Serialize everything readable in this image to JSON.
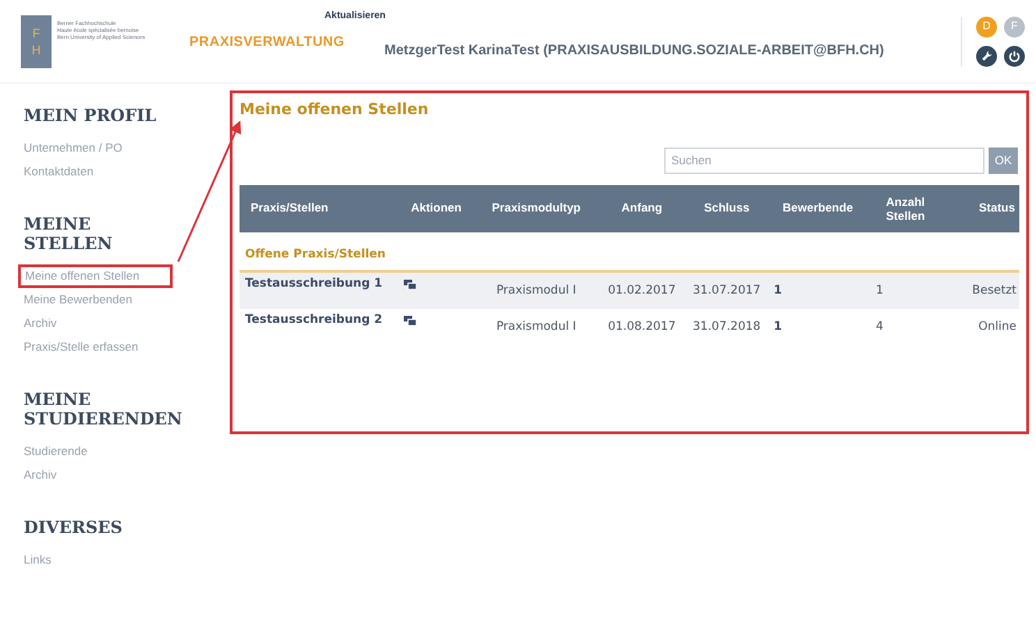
{
  "header": {
    "logo_letters": [
      "F",
      "H"
    ],
    "logo_lines": [
      "Berner Fachhochschule",
      "Haute école spécialisée bernoise",
      "Bern University of Applied Sciences"
    ],
    "refresh_link": "Aktualisieren",
    "app_title": "PRAXISVERWALTUNG",
    "user": "MetzgerTest KarinaTest (PRAXISAUSBILDUNG.SOZIALE-ARBEIT@BFH.CH)",
    "languages": [
      {
        "label": "D",
        "selected": true
      },
      {
        "label": "F",
        "selected": false
      }
    ]
  },
  "sidebar": [
    {
      "title": "MEIN PROFIL",
      "items": [
        {
          "label": "Unternehmen / PO",
          "selected": false
        },
        {
          "label": "Kontaktdaten",
          "selected": false
        }
      ]
    },
    {
      "title": "MEINE STELLEN",
      "items": [
        {
          "label": "Meine offenen Stellen",
          "selected": true
        },
        {
          "label": "Meine Bewerbenden",
          "selected": false
        },
        {
          "label": "Archiv",
          "selected": false
        },
        {
          "label": "Praxis/Stelle erfassen",
          "selected": false
        }
      ]
    },
    {
      "title": "MEINE STUDIERENDEN",
      "items": [
        {
          "label": "Studierende",
          "selected": false
        },
        {
          "label": "Archiv",
          "selected": false
        }
      ]
    },
    {
      "title": "DIVERSES",
      "items": [
        {
          "label": "Links",
          "selected": false
        }
      ]
    }
  ],
  "main": {
    "title": "Meine offenen Stellen",
    "search": {
      "placeholder": "Suchen",
      "button": "OK"
    },
    "table": {
      "columns": [
        "Praxis/Stellen",
        "Aktionen",
        "Praxismodultyp",
        "Anfang",
        "Schluss",
        "Bewerbende",
        "Anzahl Stellen",
        "Status"
      ],
      "group": "Offene Praxis/Stellen",
      "rows": [
        {
          "name": "Testausschreibung 1",
          "type": "Praxismodul I",
          "start": "01.02.2017",
          "end": "31.07.2017",
          "applicants": "1",
          "count": "1",
          "status": "Besetzt"
        },
        {
          "name": "Testausschreibung 2",
          "type": "Praxismodul I",
          "start": "01.08.2017",
          "end": "31.07.2018",
          "applicants": "1",
          "count": "4",
          "status": "Online"
        }
      ]
    }
  }
}
